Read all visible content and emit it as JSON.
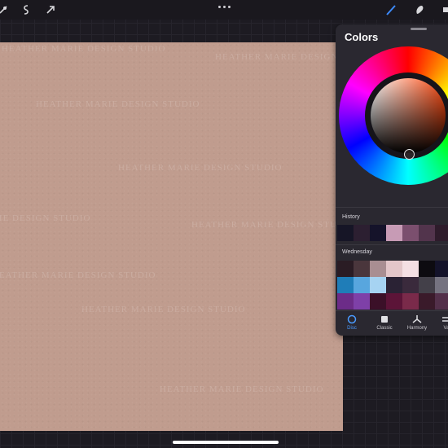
{
  "toolbar": {
    "left_tools": [
      "wrench-icon",
      "adjustments-icon",
      "selection-icon",
      "transform-icon"
    ],
    "more_icon": "ellipsis-icon",
    "right_tools": [
      "brush-icon",
      "smudge-icon",
      "eraser-icon"
    ],
    "accent": "#3d8bff"
  },
  "canvas": {
    "color": "#c09c8e",
    "watermark_lines": [
      "HEATHER MARIE DESIGN STUDIO",
      "HEATHER MARIE DESIGN STUDIO",
      "HEATHER MARIE DESIGN STUDIO",
      "HEATHER MARIE DESIGN STUDIO",
      "HEATHER MARIE DESIGN STUDIO",
      "HEATHER MARIE DESIGN STUDIO",
      "HEATHER MARIE DESIGN STUDIO",
      "HEATHER MARIE DESIGN STUDIO",
      "HEATHER MARIE DESIGN STUDIO"
    ]
  },
  "colors_panel": {
    "title": "Colors",
    "history_label": "History",
    "history": [
      "#161526",
      "#2c1f31",
      "#15132a",
      "#c79bb5",
      "#7b4f6e",
      "#52344c",
      "#2e1c2b"
    ],
    "palette_label": "Wednesday",
    "palette_rows": [
      [
        "#2a1c24",
        "#4a363c",
        "#a98e92",
        "#e3c6c9",
        "#f4dfe3",
        "#0d0b10",
        "#14132a"
      ],
      [
        "#1f7db8",
        "#58a6de",
        "#a6d3f2",
        "#2a2234",
        "#3a2a3c",
        "#434049",
        "#757380"
      ],
      [
        "#6c2c88",
        "#7e40a8",
        "#3b1028",
        "#5c1438",
        "#7a2a4a",
        "#3a1a2a",
        "#53304a"
      ]
    ],
    "tabs": [
      {
        "label": "Disc",
        "icon": "disc-icon",
        "active": true
      },
      {
        "label": "Classic",
        "icon": "square-icon",
        "active": false
      },
      {
        "label": "Harmony",
        "icon": "harmony-icon",
        "active": false
      },
      {
        "label": "Va",
        "icon": "sliders-icon",
        "active": false
      }
    ]
  }
}
